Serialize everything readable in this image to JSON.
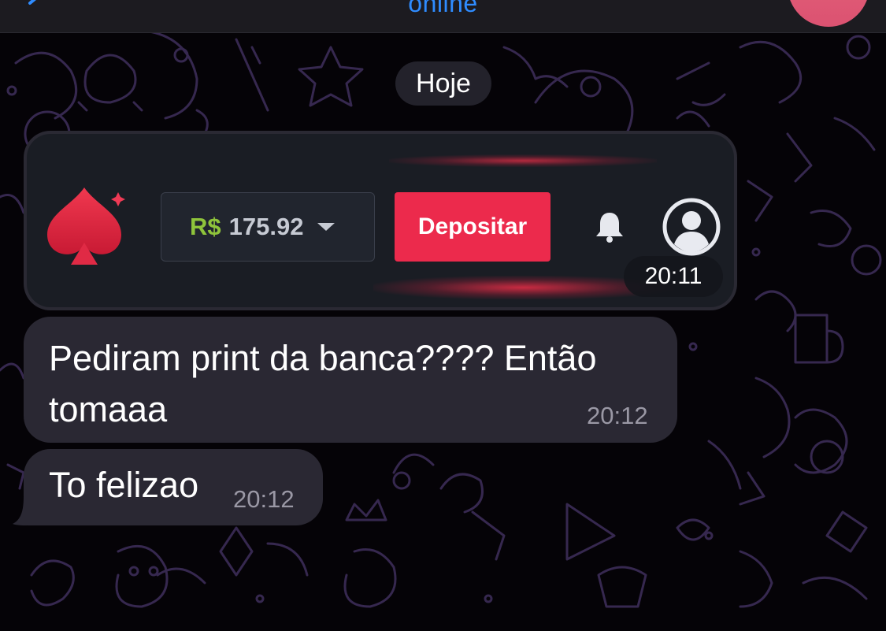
{
  "header": {
    "status": "online",
    "accent_color": "#2f8cff",
    "back_icon": "chevron-left-icon",
    "avatar_color": "#e0607a"
  },
  "date_separator": "Hoje",
  "messages": [
    {
      "type": "image",
      "time": "20:11",
      "image": {
        "logo_icon": "spade-icon",
        "balance_currency": "R$",
        "balance_amount": "175.92",
        "dropdown_icon": "caret-down-icon",
        "deposit_label": "Depositar",
        "bell_icon": "bell-icon",
        "user_icon": "user-circle-icon",
        "deposit_color": "#ec2a4c",
        "currency_color": "#8fc43b"
      }
    },
    {
      "type": "text",
      "text": "Pediram print da banca???? Então tomaaa",
      "time": "20:12"
    },
    {
      "type": "text",
      "text": "To felizao",
      "time": "20:12"
    }
  ],
  "colors": {
    "background": "#050307",
    "bubble": "#2a2833",
    "doodle": "#3a2a58"
  }
}
